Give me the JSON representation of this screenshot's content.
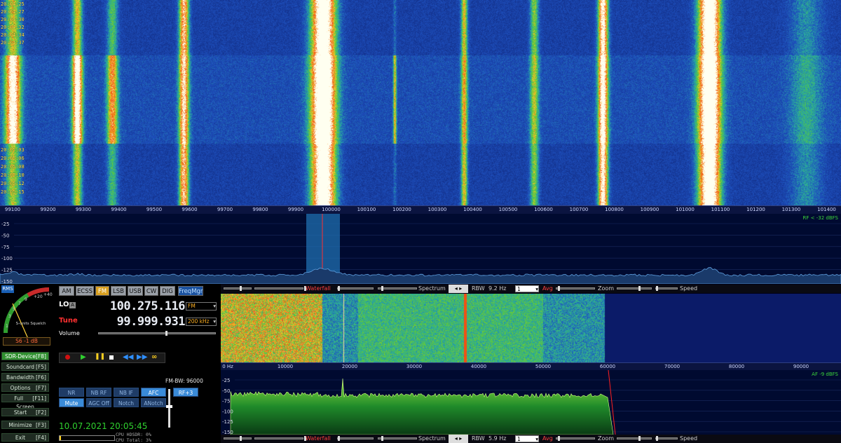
{
  "top_waterfall": {
    "timestamps": [
      "20:04:25",
      "20:04:27",
      "20:04:30",
      "20:04:32",
      "20:04:34",
      "20:04:37",
      "20:05:03",
      "20:05:06",
      "20:05:08",
      "20:05:10",
      "20:05:12",
      "20:05:15"
    ],
    "freq_labels": [
      "99100",
      "99200",
      "99300",
      "99400",
      "99500",
      "99600",
      "99700",
      "99800",
      "99900",
      "100000",
      "100100",
      "100200",
      "100300",
      "100400",
      "100500",
      "100600",
      "100700",
      "100800",
      "100900",
      "101000",
      "101100",
      "101200",
      "101300",
      "101400"
    ]
  },
  "rf_spectrum": {
    "db_labels": [
      "-25",
      "-50",
      "-75",
      "-100",
      "-125",
      "-150"
    ],
    "status": "RF < -32 dBFS"
  },
  "modes": [
    "AM",
    "ECSS",
    "FM",
    "LSB",
    "USB",
    "CW",
    "DIG"
  ],
  "selected_mode": "FM",
  "freq_mgr": "FreqMgr",
  "meter": {
    "rms": "RMS",
    "scale_label": "S-units Squelch",
    "ticks": [
      "1",
      "3",
      "5",
      "7",
      "9",
      "+20",
      "+40"
    ],
    "reading": "S6 -1 dB"
  },
  "lo": {
    "label": "LO",
    "badge": "A",
    "value": "100.275.116",
    "mode_select": "FM"
  },
  "tune": {
    "label": "Tune",
    "value": "99.999.931",
    "bw_select": "200 kHz"
  },
  "volume": {
    "label": "Volume"
  },
  "side_buttons": [
    {
      "label": "SDR-Device",
      "key": "[F8]",
      "active": true
    },
    {
      "label": "Soundcard",
      "key": "[F5]",
      "active": false
    },
    {
      "label": "Bandwidth",
      "key": "[F6]",
      "active": false
    },
    {
      "label": "Options",
      "key": "[F7]",
      "active": false
    },
    {
      "label": "Full Screen",
      "key": "[F11]",
      "active": false
    },
    {
      "label": "Start",
      "key": "[F2]",
      "active": false
    },
    {
      "label": "Minimize",
      "key": "[F3]",
      "active": false
    },
    {
      "label": "Exit",
      "key": "[F4]",
      "active": false
    }
  ],
  "dsp_row1": [
    {
      "label": "NR",
      "on": false
    },
    {
      "label": "NB RF",
      "on": false
    },
    {
      "label": "NB IF",
      "on": false
    },
    {
      "label": "AFC",
      "on": true
    }
  ],
  "dsp_row2": [
    {
      "label": "Mute",
      "on": true
    },
    {
      "label": "AGC Off",
      "on": false
    },
    {
      "label": "Notch",
      "on": false
    },
    {
      "label": "ANotch",
      "on": false
    }
  ],
  "rf_plus": "RF+3",
  "fm_bw": "FM-BW: 96000",
  "datetime": "10.07.2021 20:05:45",
  "cpu_hdsdr": "CPU HDSDR: 0%",
  "cpu_total": "CPU Total: 3%",
  "toolbar_top": {
    "waterfall": "Waterfall",
    "spectrum": "Spectrum",
    "rbw_label": "RBW",
    "rbw_value": "9.2 Hz",
    "avg_select": "1",
    "avg": "Avg",
    "zoom": "Zoom",
    "speed": "Speed"
  },
  "toolbar_bottom": {
    "waterfall": "Waterfall",
    "spectrum": "Spectrum",
    "rbw_label": "RBW",
    "rbw_value": "5.9 Hz",
    "avg_select": "1",
    "avg": "Avg",
    "zoom": "Zoom",
    "speed": "Speed"
  },
  "af_axis": [
    "0 Hz",
    "10000",
    "20000",
    "30000",
    "40000",
    "50000",
    "60000",
    "70000",
    "80000",
    "90000"
  ],
  "af_spectrum": {
    "db_labels": [
      "-25",
      "-50",
      "-75",
      "-100",
      "-125",
      "-150"
    ],
    "status": "AF -9 dBFS"
  }
}
